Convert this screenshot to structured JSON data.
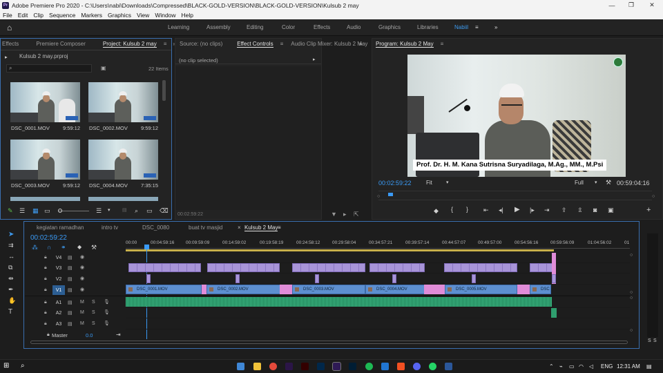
{
  "window": {
    "title": "Adobe Premiere Pro 2020 - C:\\Users\\nabi\\Downloads\\Compressed\\BLACK-GOLD-VERSION\\BLACK-GOLD-VERSION\\Kulsub 2 may",
    "logo": "Pr",
    "controls": [
      "—",
      "❐",
      "✕"
    ]
  },
  "menu": [
    "File",
    "Edit",
    "Clip",
    "Sequence",
    "Markers",
    "Graphics",
    "View",
    "Window",
    "Help"
  ],
  "workspaces": {
    "tabs": [
      "Learning",
      "Assembly",
      "Editing",
      "Color",
      "Effects",
      "Audio",
      "Graphics",
      "Libraries",
      "Nabiil"
    ],
    "active": "Nabiil",
    "more": "»"
  },
  "project_panel": {
    "tabs": [
      "Effects",
      "Premiere Composer",
      "Project: Kulsub 2 may"
    ],
    "active_tab": "Project: Kulsub 2 may",
    "menu_glyph": "≡",
    "more": "»",
    "file": "Kulsub 2 may.prproj",
    "item_count": "22 Items",
    "search_placeholder": "",
    "clips": [
      {
        "name": "DSC_0001.MOV",
        "duration": "9:59:12"
      },
      {
        "name": "DSC_0002.MOV",
        "duration": "9:59:12"
      },
      {
        "name": "DSC_0003.MOV",
        "duration": "9:59:12"
      },
      {
        "name": "DSC_0004.MOV",
        "duration": "7:35:15"
      }
    ]
  },
  "effect_panel": {
    "tabs": [
      "Source: (no clips)",
      "Effect Controls",
      "Audio Clip Mixer: Kulsub 2 May"
    ],
    "active_tab": "Effect Controls",
    "menu_glyph": "≡",
    "more": "»",
    "status": "(no clip selected)",
    "timecode": "00:02:59:22"
  },
  "program_panel": {
    "tab": "Program: Kulsub 2 May",
    "menu_glyph": "≡",
    "caption": "Prof. Dr. H. M.  Kana Sutrisna Suryadilaga, M.Ag., MM., M.Psi",
    "timecode": "00:02:59:22",
    "zoom": "Fit",
    "resolution": "Full",
    "duration": "00:59:04:16"
  },
  "timeline": {
    "tabs": [
      "kegiatan ramadhan",
      "intro tv",
      "DSC_0080",
      "buat tv masjid",
      "Kulsub 2 May"
    ],
    "active_tab": "Kulsub 2 May",
    "close_glyph": "×",
    "menu_glyph": "≡",
    "timecode": "00:02:59:22",
    "ruler": [
      "00:00",
      "00:04:59:16",
      "00:09:59:09",
      "00:14:59:02",
      "00:19:58:19",
      "00:24:58:12",
      "00:29:58:04",
      "00:34:57:21",
      "00:39:57:14",
      "00:44:57:07",
      "00:49:57:00",
      "00:54:56:16",
      "00:59:56:09",
      "01:04:56:02",
      "01"
    ],
    "video_tracks": [
      "V4",
      "V3",
      "V2",
      "V1"
    ],
    "audio_tracks": [
      "A1",
      "A2",
      "A3"
    ],
    "master": {
      "label": "Master",
      "value": "0.0"
    },
    "v1_clips": [
      "DSC_0001.MOV",
      "DSC_0002.MOV",
      "DSC_0003.MOV",
      "DSC_0004.MOV",
      "DSC_0005.MOV",
      "DSC"
    ],
    "track_toggles": {
      "mute": "M",
      "solo": "S"
    }
  },
  "meter": {
    "labels": [
      "S",
      "S"
    ]
  },
  "taskbar": {
    "language": "ENG",
    "time": "12:31 AM"
  },
  "colors": {
    "accent": "#3a9af5",
    "video_clip": "#a894d8",
    "v1_clip": "#5d8fd0",
    "audio_clip": "#2f9e6e",
    "transition": "#e08cd8"
  }
}
